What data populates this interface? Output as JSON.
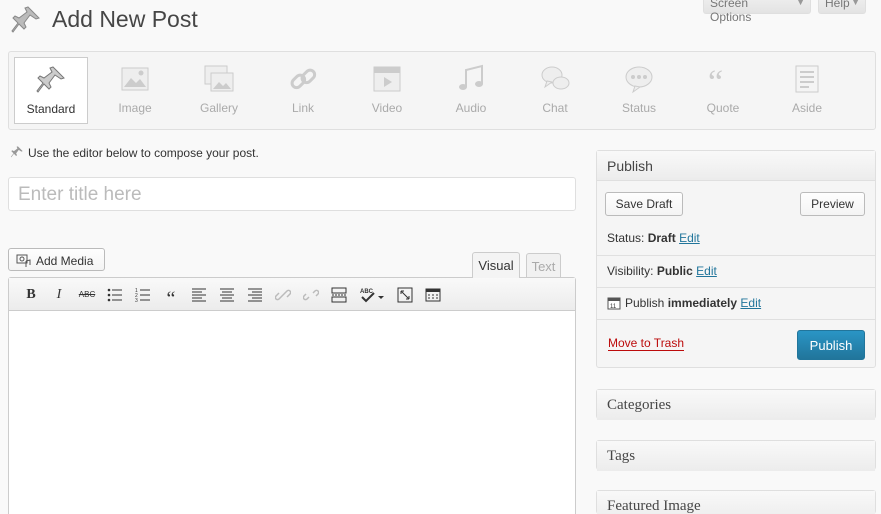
{
  "header": {
    "title": "Add New Post",
    "screen_options": "Screen Options",
    "help": "Help"
  },
  "formats": [
    {
      "label": "Standard",
      "icon": "pushpin-icon",
      "active": true
    },
    {
      "label": "Image",
      "icon": "image-icon"
    },
    {
      "label": "Gallery",
      "icon": "gallery-icon"
    },
    {
      "label": "Link",
      "icon": "link-icon"
    },
    {
      "label": "Video",
      "icon": "video-icon"
    },
    {
      "label": "Audio",
      "icon": "audio-icon"
    },
    {
      "label": "Chat",
      "icon": "chat-icon"
    },
    {
      "label": "Status",
      "icon": "status-icon"
    },
    {
      "label": "Quote",
      "icon": "quote-icon"
    },
    {
      "label": "Aside",
      "icon": "aside-icon"
    }
  ],
  "notice": "Use the editor below to compose your post.",
  "title_input": {
    "placeholder": "Enter title here",
    "value": ""
  },
  "editor": {
    "add_media": "Add Media",
    "tab_visual": "Visual",
    "tab_text": "Text",
    "toolbar": {
      "bold": "B",
      "italic": "I",
      "strike": "ABC",
      "blockquote": "“"
    }
  },
  "publish": {
    "title": "Publish",
    "save_draft": "Save Draft",
    "preview": "Preview",
    "status_label": "Status:",
    "status_value": "Draft",
    "visibility_label": "Visibility:",
    "visibility_value": "Public",
    "publish_label": "Publish",
    "publish_value": "immediately",
    "edit": "Edit",
    "move_to_trash": "Move to Trash",
    "publish_button": "Publish"
  },
  "boxes": {
    "categories": "Categories",
    "tags": "Tags",
    "featured_image": "Featured Image"
  },
  "colors": {
    "link": "#21759b",
    "trash": "#bc0b0b",
    "primary_button": "#21759b"
  }
}
